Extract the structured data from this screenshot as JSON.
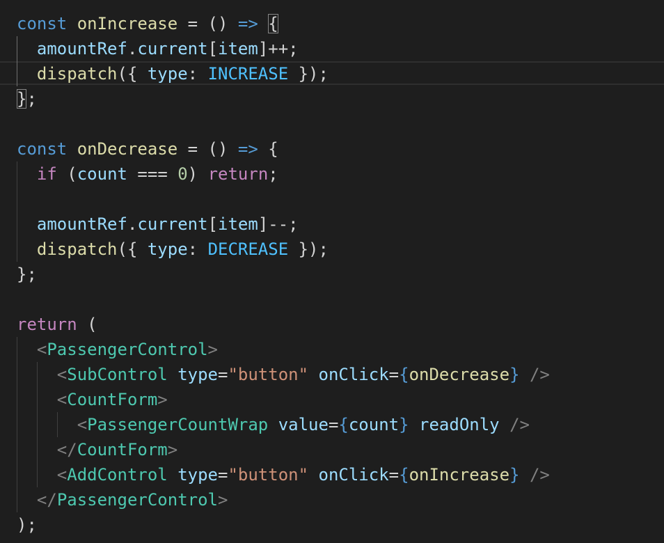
{
  "code": {
    "l1": {
      "kw": "const",
      "name": "onIncrease",
      "op": " = () ",
      "arrow": "=>",
      "brace": "{"
    },
    "l2": {
      "obj": "amountRef",
      "prop": "current",
      "key": "item",
      "tail": "]++;"
    },
    "l3": {
      "fn": "dispatch",
      "open": "({ ",
      "key": "type",
      "colon": ": ",
      "val": "INCREASE",
      "close": " });"
    },
    "l4": {
      "brace": "}",
      "semi": ";"
    },
    "l6": {
      "kw": "const",
      "name": "onDecrease",
      "op": " = () ",
      "arrow": "=>",
      "brace": " {"
    },
    "l7": {
      "kw": "if",
      "open": " (",
      "var": "count",
      "op": " === ",
      "num": "0",
      "close": ") ",
      "ret": "return",
      "semi": ";"
    },
    "l9": {
      "obj": "amountRef",
      "prop": "current",
      "key": "item",
      "tail": "]--;"
    },
    "l10": {
      "fn": "dispatch",
      "open": "({ ",
      "key": "type",
      "colon": ": ",
      "val": "DECREASE",
      "close": " });"
    },
    "l11": {
      "text": "};"
    },
    "l13": {
      "kw": "return",
      "paren": " ("
    },
    "l14": {
      "tag": "PassengerControl"
    },
    "l15": {
      "tag": "SubControl",
      "attr1": "type",
      "val1": "\"button\"",
      "attr2": "onClick",
      "expr": "onDecrease"
    },
    "l16": {
      "tag": "CountForm"
    },
    "l17": {
      "tag": "PassengerCountWrap",
      "attr1": "value",
      "expr": "count",
      "attr2": "readOnly"
    },
    "l18": {
      "tag": "CountForm"
    },
    "l19": {
      "tag": "AddControl",
      "attr1": "type",
      "val1": "\"button\"",
      "attr2": "onClick",
      "expr": "onIncrease"
    },
    "l20": {
      "tag": "PassengerControl"
    },
    "l21": {
      "text": ");"
    }
  }
}
